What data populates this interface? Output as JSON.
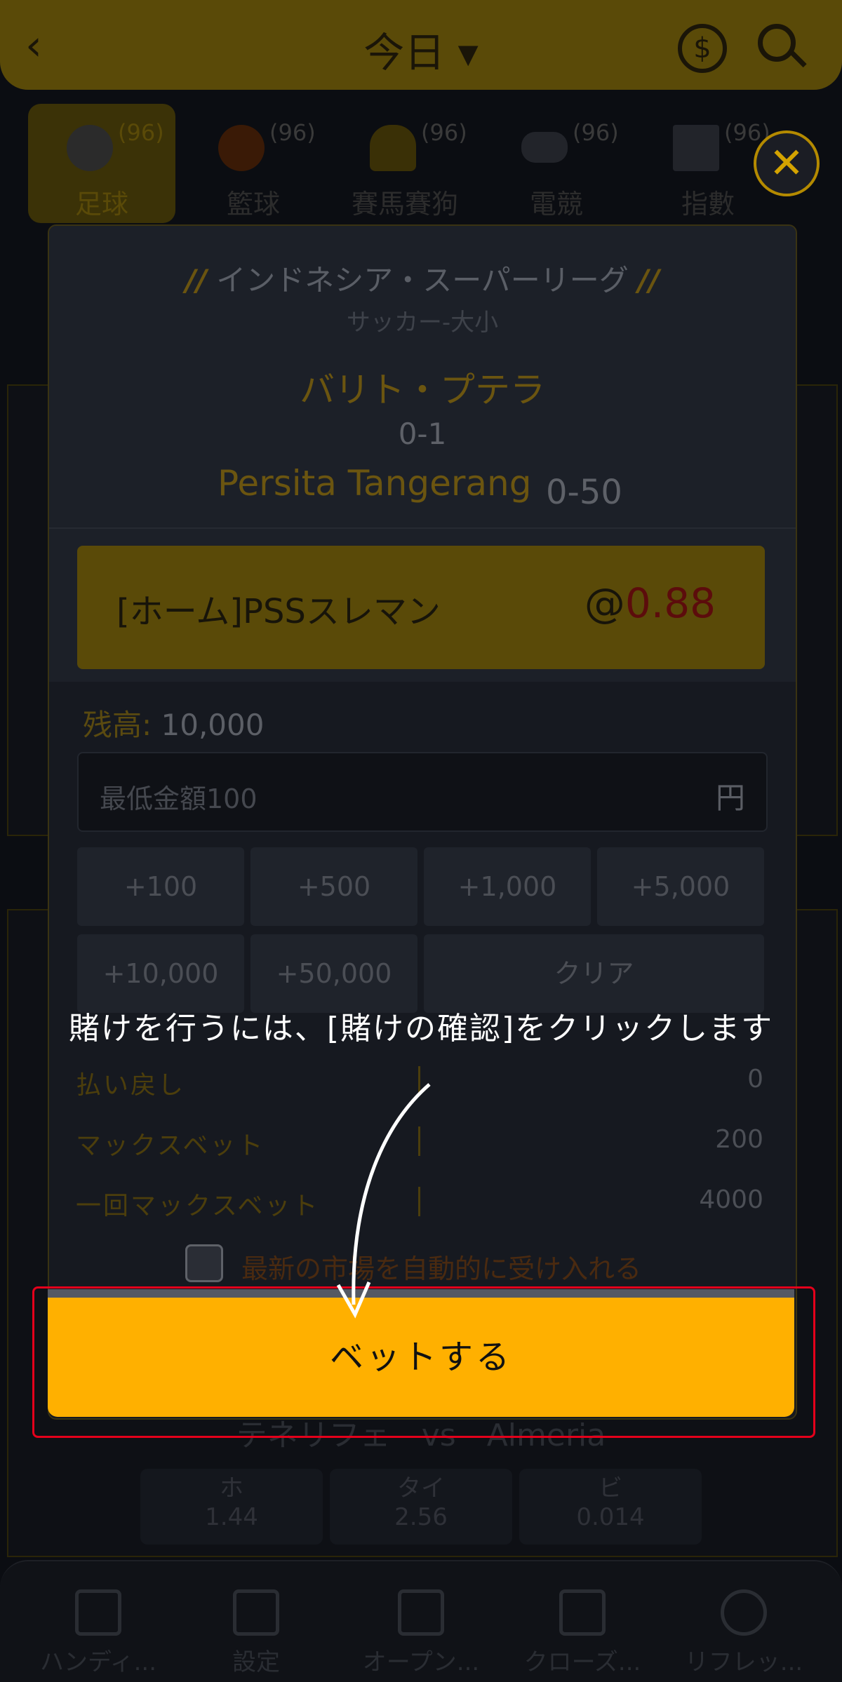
{
  "header": {
    "back_icon": "chevron-left-icon",
    "title": "今日 ▾",
    "coin_icon": "dollar-coin-icon",
    "search_icon": "search-icon"
  },
  "sports": [
    {
      "label": "足球",
      "count": "(96)",
      "icon": "soccer-ball-icon"
    },
    {
      "label": "籃球",
      "count": "(96)",
      "icon": "basketball-icon"
    },
    {
      "label": "賽馬賽狗",
      "count": "(96)",
      "icon": "horseshoe-icon"
    },
    {
      "label": "電競",
      "count": "(96)",
      "icon": "gamepad-icon"
    },
    {
      "label": "指數",
      "count": "(96)",
      "icon": "index-chart-icon"
    }
  ],
  "background": {
    "match": "テネリフェ　vs　Almeria",
    "odds": [
      {
        "k": "ホ",
        "v": "1.44"
      },
      {
        "k": "タイ",
        "v": "2.56"
      },
      {
        "k": "ビ",
        "v": "0.014"
      }
    ]
  },
  "bottom_nav": [
    "ハンディ...",
    "設定",
    "オープン...",
    "クローズ...",
    "リフレッ..."
  ],
  "modal": {
    "league": "インドネシア・スーパーリーグ",
    "subtitle": "サッカー-大小",
    "home_team": "バリト・プテラ",
    "score1": "0-1",
    "away_team": "Persita Tangerang",
    "score2": "0-50",
    "pick": {
      "selection": "[ホーム]PSSスレマン",
      "at": "@",
      "odds": "0.88"
    },
    "balance_label": "残高:",
    "balance_value": "10,000",
    "amount": {
      "placeholder": "最低金額100",
      "currency": "円"
    },
    "quick": [
      "+100",
      "+500",
      "+1,000",
      "+5,000",
      "+10,000",
      "+50,000"
    ],
    "clear_label": "クリア",
    "info": [
      {
        "k": "払い戻し",
        "v": "0"
      },
      {
        "k": "マックスベット",
        "v": "200"
      },
      {
        "k": "一回マックスベット",
        "v": "4000"
      }
    ],
    "auto_accept": "最新の市場を自動的に受け入れる",
    "bet_button": "ベットする"
  },
  "hint": "賭けを行うには、[賭けの確認]をクリックします",
  "colors": {
    "accent": "#ffb000",
    "highlight": "#e4001b",
    "overlay": "#0b0d12"
  }
}
